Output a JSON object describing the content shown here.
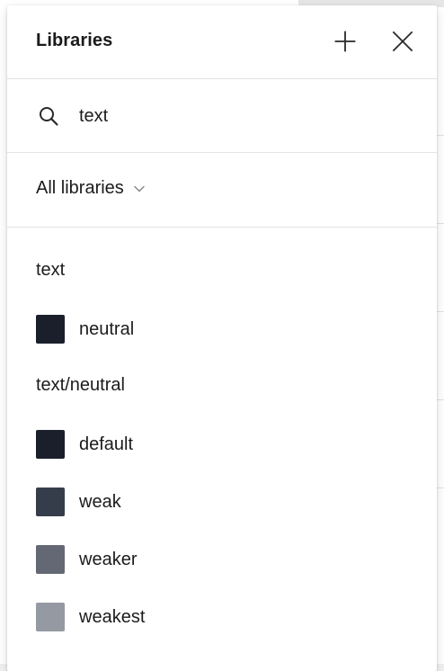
{
  "panel": {
    "title": "Libraries",
    "actions": [
      {
        "icon": "plus-icon",
        "label": "Add library"
      },
      {
        "icon": "close-icon",
        "label": "Close"
      }
    ]
  },
  "search": {
    "icon": "search-icon",
    "value": "text"
  },
  "filter": {
    "label": "All libraries",
    "icon": "chevron-down-icon"
  },
  "groups": [
    {
      "header": "text",
      "items": [
        {
          "name": "neutral",
          "color": "#1a1f2b"
        }
      ]
    },
    {
      "header": "text/neutral",
      "items": [
        {
          "name": "default",
          "color": "#1a1f2b"
        },
        {
          "name": "weak",
          "color": "#363d4a"
        },
        {
          "name": "weaker",
          "color": "#636874"
        },
        {
          "name": "weakest",
          "color": "#9599a1"
        }
      ]
    }
  ],
  "colors": {
    "text": "#1b1b1b",
    "divider": "#e3e3e3",
    "icon": "#2a2a2a",
    "chevron": "#8a8a8a"
  }
}
